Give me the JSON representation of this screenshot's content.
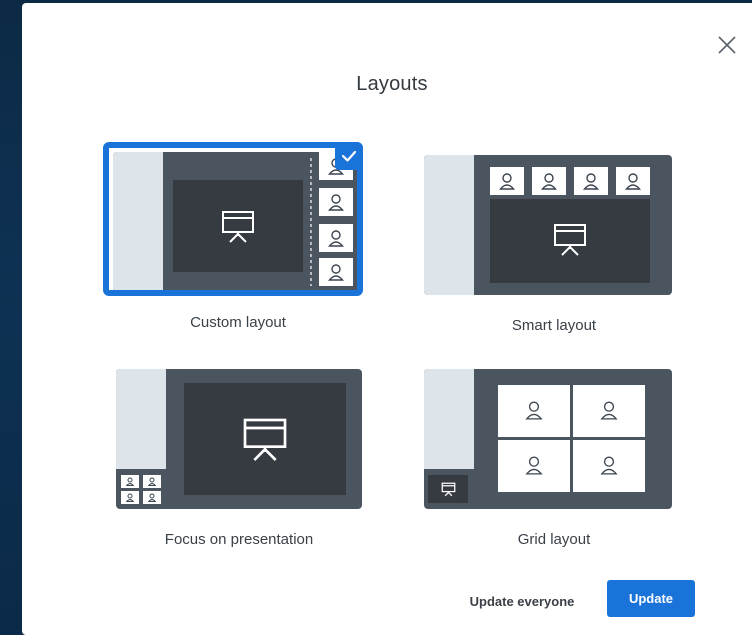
{
  "dialog": {
    "title": "Layouts",
    "close_icon": "close-icon"
  },
  "layouts": [
    {
      "id": "custom",
      "label": "Custom layout",
      "selected": true
    },
    {
      "id": "smart",
      "label": "Smart layout",
      "selected": false
    },
    {
      "id": "focus",
      "label": "Focus on presentation",
      "selected": false
    },
    {
      "id": "grid",
      "label": "Grid layout",
      "selected": false
    }
  ],
  "footer": {
    "secondary_label": "Update everyone",
    "primary_label": "Update"
  },
  "colors": {
    "accent": "#1a73d9",
    "thumb_bg": "#4b5560",
    "presentation": "#363a41",
    "sidebar": "#dde4ea"
  }
}
